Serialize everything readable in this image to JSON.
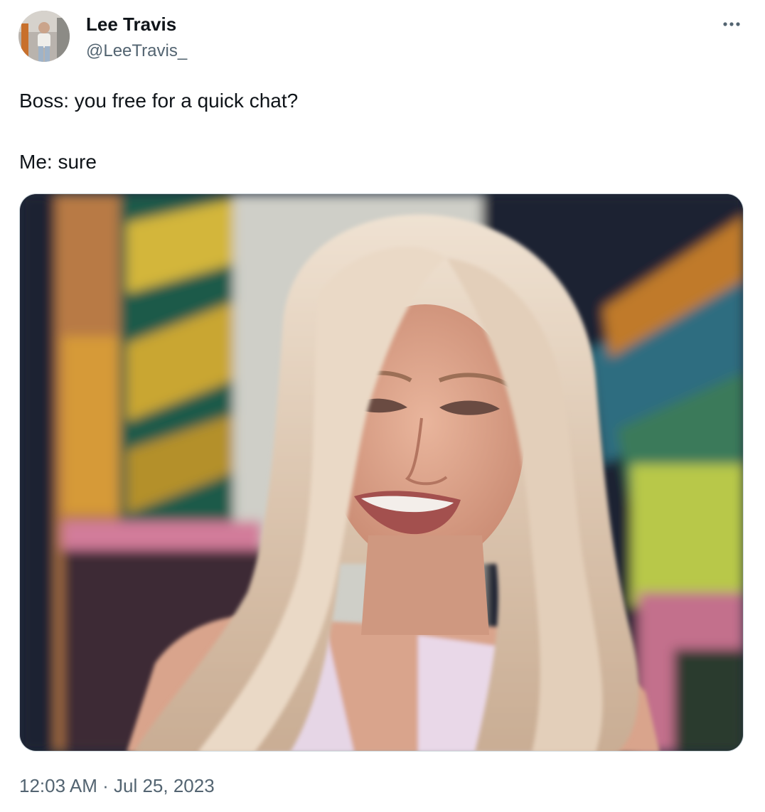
{
  "author": {
    "display_name": "Lee Travis",
    "handle": "@LeeTravis_"
  },
  "icons": {
    "more": "more-horizontal-icon"
  },
  "tweet": {
    "lines": [
      "Boss: you free for a quick chat?",
      "Me: sure"
    ]
  },
  "meta": {
    "time": "12:03 AM",
    "separator": "·",
    "date": "Jul 25, 2023"
  },
  "colors": {
    "text_primary": "#0f1419",
    "text_secondary": "#536471",
    "border": "#cfd9de"
  }
}
